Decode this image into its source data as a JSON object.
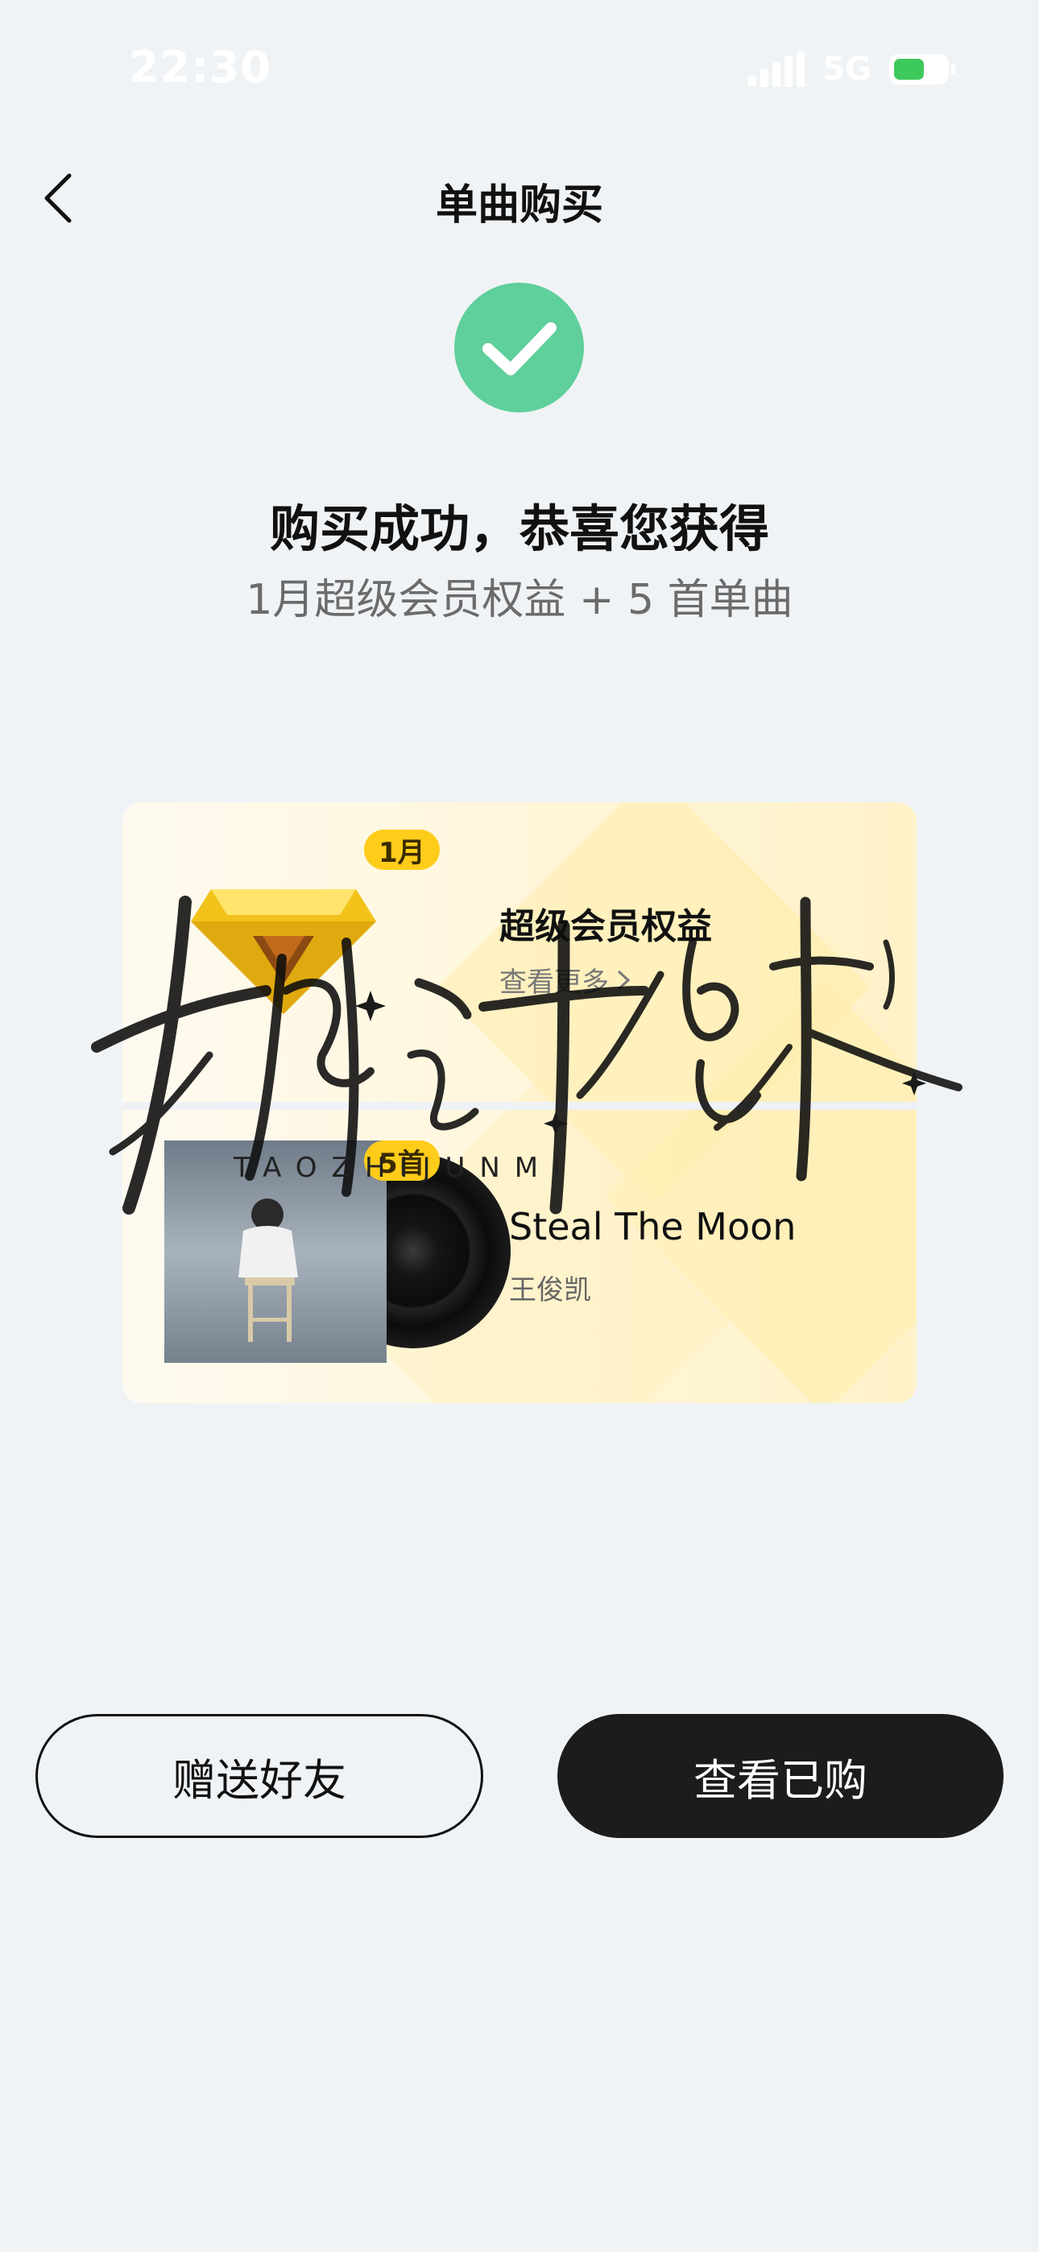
{
  "status_bar": {
    "time": "22:30",
    "network": "5G",
    "battery_level": 0.6
  },
  "nav": {
    "title": "单曲购买",
    "back_icon": "chevron-left-icon"
  },
  "success": {
    "icon": "check-circle-icon",
    "title": "购买成功，恭喜您获得",
    "subtitle": "1月超级会员权益 + 5 首单曲"
  },
  "card": {
    "vip": {
      "badge": "1月",
      "title": "超级会员权益",
      "link": "查看更多",
      "link_icon": "chevron-right-icon"
    },
    "songs": {
      "badge": "5首",
      "title": "Steal The Moon",
      "artist": "王俊凯"
    }
  },
  "buttons": {
    "gift": "赠送好友",
    "view": "查看已购"
  },
  "watermark": {
    "text": "TAOZHIJUNMI"
  },
  "colors": {
    "success_green": "#5fcf9b",
    "badge_yellow": "#ffcc1a",
    "primary_button": "#1c1c1c",
    "battery_green": "#3ec95d"
  }
}
